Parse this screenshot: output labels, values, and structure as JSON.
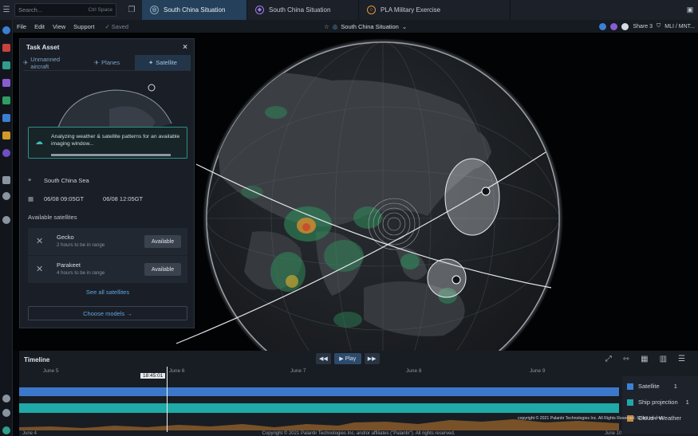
{
  "search": {
    "placeholder": "Search...",
    "shortcut": "Ctrl Space"
  },
  "tabs": [
    {
      "label": "South China Situation"
    },
    {
      "label": "South China Situation"
    },
    {
      "label": "PLA Military Exercise"
    }
  ],
  "menu": {
    "items": [
      "File",
      "Edit",
      "View",
      "Support"
    ],
    "saved": "✓ Saved",
    "center_title": "South China Situation",
    "share": "Share 3",
    "classification": "MLI / MNT..."
  },
  "panel": {
    "title": "Task Asset",
    "tabs": [
      "Unmanned aircraft",
      "Planes",
      "Satellite"
    ],
    "notice": "Analyzing weather & satellite patterns for an available imaging window...",
    "notice_progress": 1.0,
    "location": "South China Sea",
    "start_time": "06/08 09:05GT",
    "end_time": "06/08 12:05GT",
    "available_label": "Available satellites",
    "satellites": [
      {
        "name": "Gecko",
        "desc": "2 hours to be in range",
        "button": "Available"
      },
      {
        "name": "Parakeet",
        "desc": "4 hours to be in range",
        "button": "Available"
      }
    ],
    "see_all": "See all satellites",
    "choose": "Choose models →"
  },
  "timeline": {
    "title": "Timeline",
    "play": "▶ Play",
    "dates": [
      "June 5",
      "June 6",
      "June 7",
      "June 8",
      "June 9"
    ],
    "cursor": "18:45:01",
    "start_date": "June 4",
    "end_date": "June 10",
    "legend": [
      {
        "label": "Satellite",
        "color": "#3b82d6",
        "value": "1"
      },
      {
        "label": "Ship projection",
        "color": "#1fa9a8",
        "value": "1"
      },
      {
        "label": "Cloud / Weather",
        "color": "#c8893a",
        "value": ""
      }
    ],
    "map_credit": "copyright © 2021 Palantir Technologies Inc. All Rights Reserved. Glob3 Internal.",
    "copyright": "Copyright © 2021 Palantir Technologies Inc. and/or affiliates (\"Palantir\"). All rights reserved."
  },
  "colors": {
    "accent": "#2d6fa8",
    "teal": "#2e8f86",
    "link": "#5ea4e4"
  }
}
